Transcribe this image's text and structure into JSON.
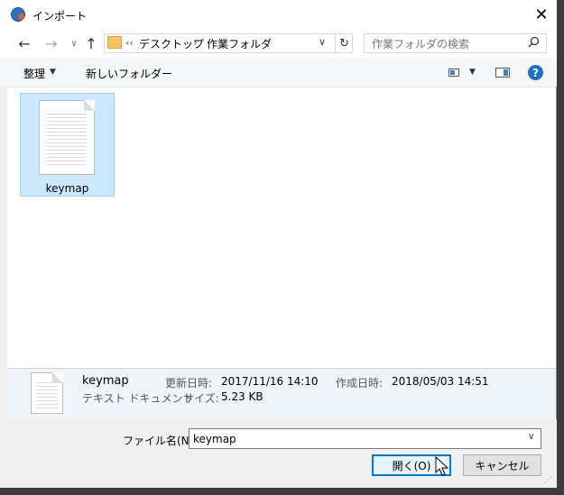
{
  "window": {
    "title": "インポート",
    "close_glyph": "✕"
  },
  "nav": {
    "back_glyph": "←",
    "forward_glyph": "→",
    "recent_glyph": "∨",
    "up_glyph": "↑",
    "breadcrumb_prefix": "‹‹",
    "breadcrumb": [
      "デスクトップ",
      "作業フォルダ"
    ],
    "breadcrumb_separator": "›",
    "dropdown_glyph": "∨",
    "refresh_glyph": "↻",
    "search_placeholder": "作業フォルダの検索",
    "search_icon": "search-icon"
  },
  "toolbar": {
    "organize_label": "整理",
    "new_folder_label": "新しいフォルダー",
    "help_label": "?"
  },
  "files": [
    {
      "name": "keymap",
      "selected": true
    }
  ],
  "details": {
    "name": "keymap",
    "type": "テキスト ドキュメント",
    "modified_label": "更新日時:",
    "modified_value": "2017/11/16 14:10",
    "size_label": "サイズ:",
    "size_value": "5.23 KB",
    "created_label": "作成日時:",
    "created_value": "2018/05/03 14:51"
  },
  "footer": {
    "filename_label": "ファイル名(N):",
    "filename_value": "keymap",
    "open_label": "開く(O)",
    "cancel_label": "キャンセル"
  },
  "colors": {
    "selection_fill": "#cce8ff",
    "selection_border": "#99d1ff",
    "accent": "#0078d7",
    "details_background": "#eef4fa"
  }
}
